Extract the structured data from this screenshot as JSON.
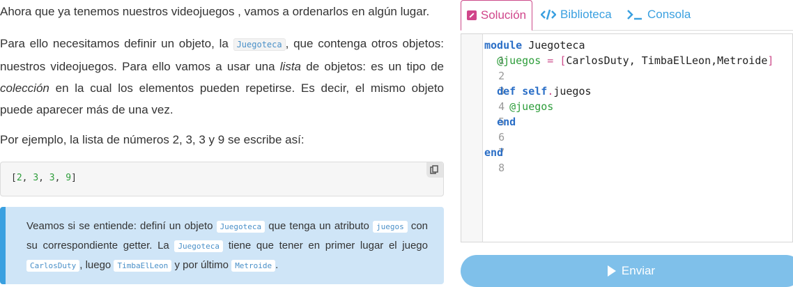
{
  "text": {
    "p1": "Ahora que ya tenemos nuestros videojuegos , vamos a ordenarlos en algún lugar.",
    "p2a": "Para ello necesitamos definir un objeto, la ",
    "p2_code": "Juegoteca",
    "p2b": ", que contenga otros objetos: nuestros videojuegos. Para ello vamos a usar una ",
    "p2_em1": "lista",
    "p2c": " de objetos: es un tipo de ",
    "p2_em2": "colección",
    "p2d": " en la cual los elementos pueden repetirse. Es decir, el mismo objeto puede aparecer más de una vez.",
    "p3": "Por ejemplo, la lista de números 2, 3, 3 y 9 se escribe así:"
  },
  "example_code": {
    "open": "[",
    "n1": "2",
    "sep": ", ",
    "n2": "3",
    "n3": "3",
    "n4": "9",
    "close": "]"
  },
  "alert": {
    "a": "Veamos si se entiende: definí un objeto ",
    "c1": "Juegoteca",
    "b": " que tenga un atributo ",
    "c2": "juegos",
    "c": " con su correspondiente getter. La ",
    "c3": "Juegoteca",
    "d": " tiene que tener en primer lugar el juego ",
    "c4": "CarlosDuty",
    "e": ", luego ",
    "c5": "TimbaElLeon",
    "f": " y por último ",
    "c6": "Metroide",
    "g": "."
  },
  "tabs": {
    "solucion": "Solución",
    "biblioteca": "Biblioteca",
    "consola": "Consola"
  },
  "editor": {
    "lines": [
      {
        "n": "1",
        "kw": "module",
        "rest": " Juegoteca"
      },
      {
        "n": "2",
        "iv": "@juegos",
        "eq": " = ",
        "ob": "[",
        "list": "CarlosDuty, TimbaElLeon,Metroide",
        "cb": "]"
      },
      {
        "n": "3"
      },
      {
        "n": "4",
        "kw": "def",
        "self": "self",
        "dot": ".",
        "rest": "juegos"
      },
      {
        "n": "5",
        "iv": "@juegos"
      },
      {
        "n": "6",
        "kw": "end"
      },
      {
        "n": "7"
      },
      {
        "n": "8",
        "kw": "end"
      }
    ]
  },
  "submit": {
    "label": "Enviar"
  },
  "colors": {
    "accent": "#3aa0e0",
    "active_tab": "#d0458a",
    "button": "#7fc0ea"
  }
}
